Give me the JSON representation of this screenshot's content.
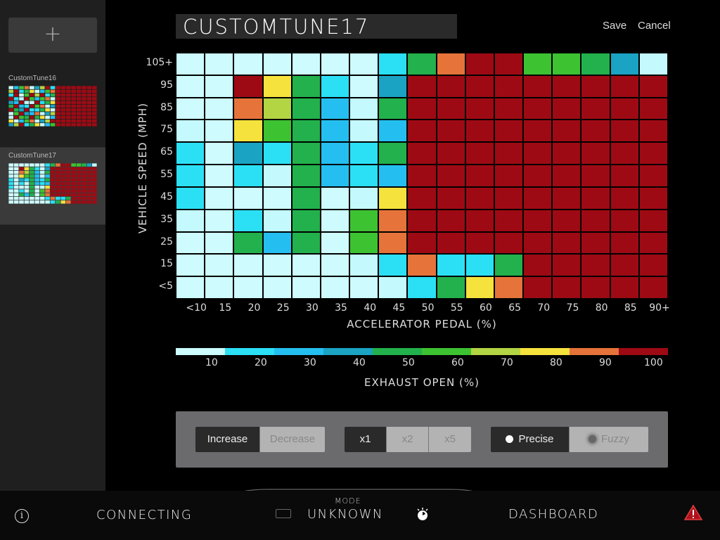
{
  "sidebar": {
    "add_label": "+",
    "tunes": [
      {
        "label": "CustomTune16",
        "selected": false
      },
      {
        "label": "CustomTune17",
        "selected": true
      }
    ]
  },
  "header": {
    "title": "CUSTOMTUNE17",
    "save_label": "Save",
    "cancel_label": "Cancel"
  },
  "chart_data": {
    "type": "heatmap",
    "title": "",
    "xlabel": "ACCELERATOR PEDAL (%)",
    "ylabel": "VEHICLE SPEED (MPH)",
    "x": [
      "<10",
      "15",
      "20",
      "25",
      "30",
      "35",
      "40",
      "45",
      "50",
      "55",
      "60",
      "65",
      "70",
      "75",
      "80",
      "85",
      "90+"
    ],
    "y": [
      "105+",
      "95",
      "85",
      "75",
      "65",
      "55",
      "45",
      "35",
      "25",
      "15",
      "<5"
    ],
    "values": [
      [
        0,
        0,
        0,
        0,
        0,
        0,
        0,
        20,
        50,
        90,
        100,
        100,
        60,
        60,
        50,
        40,
        10
      ],
      [
        0,
        0,
        100,
        80,
        50,
        20,
        0,
        40,
        100,
        100,
        100,
        100,
        100,
        100,
        100,
        100,
        100
      ],
      [
        0,
        0,
        90,
        70,
        50,
        30,
        10,
        45,
        100,
        100,
        100,
        100,
        100,
        100,
        100,
        100,
        100
      ],
      [
        10,
        0,
        80,
        60,
        50,
        30,
        10,
        30,
        100,
        100,
        100,
        100,
        100,
        100,
        100,
        100,
        100
      ],
      [
        20,
        0,
        40,
        20,
        50,
        30,
        20,
        50,
        100,
        100,
        100,
        100,
        100,
        100,
        100,
        100,
        100
      ],
      [
        20,
        0,
        20,
        10,
        50,
        30,
        20,
        30,
        100,
        100,
        100,
        100,
        100,
        100,
        100,
        100,
        100
      ],
      [
        20,
        0,
        0,
        0,
        50,
        0,
        10,
        80,
        100,
        100,
        100,
        100,
        100,
        100,
        100,
        100,
        100
      ],
      [
        10,
        0,
        20,
        10,
        50,
        0,
        60,
        90,
        100,
        100,
        100,
        100,
        100,
        100,
        100,
        100,
        100
      ],
      [
        0,
        0,
        45,
        30,
        50,
        0,
        60,
        85,
        100,
        100,
        100,
        100,
        100,
        100,
        100,
        100,
        100
      ],
      [
        0,
        0,
        0,
        0,
        0,
        0,
        10,
        20,
        85,
        20,
        20,
        50,
        100,
        100,
        100,
        100,
        100
      ],
      [
        0,
        0,
        0,
        0,
        0,
        0,
        0,
        10,
        20,
        50,
        80,
        85,
        100,
        100,
        100,
        100,
        100
      ]
    ],
    "colorbar": {
      "label": "EXHAUST OPEN (%)",
      "ticks": [
        "10",
        "20",
        "30",
        "40",
        "50",
        "60",
        "70",
        "80",
        "90",
        "100"
      ],
      "colors": [
        "#c4fafd",
        "#2be0f5",
        "#24bff0",
        "#1aa3c2",
        "#22b14c",
        "#3dc232",
        "#b3d443",
        "#f5e23c",
        "#e6733a",
        "#9e0a14"
      ]
    }
  },
  "controls": {
    "direction": [
      {
        "label": "Increase",
        "active": true
      },
      {
        "label": "Decrease",
        "active": false
      }
    ],
    "multiplier": [
      {
        "label": "x1",
        "active": true
      },
      {
        "label": "x2",
        "active": false
      },
      {
        "label": "x5",
        "active": false
      }
    ],
    "mode": [
      {
        "label": "Precise",
        "active": true
      },
      {
        "label": "Fuzzy",
        "active": false
      }
    ]
  },
  "bottom_bar": {
    "connection_status": "CONNECTING",
    "mode_label": "MODE",
    "mode_value": "UNKNOWN",
    "dashboard_label": "DASHBOARD",
    "info_glyph": "i"
  },
  "icons": {
    "info": "info-icon",
    "warning": "warning-icon",
    "timer": "timer-icon",
    "card": "card-icon"
  }
}
